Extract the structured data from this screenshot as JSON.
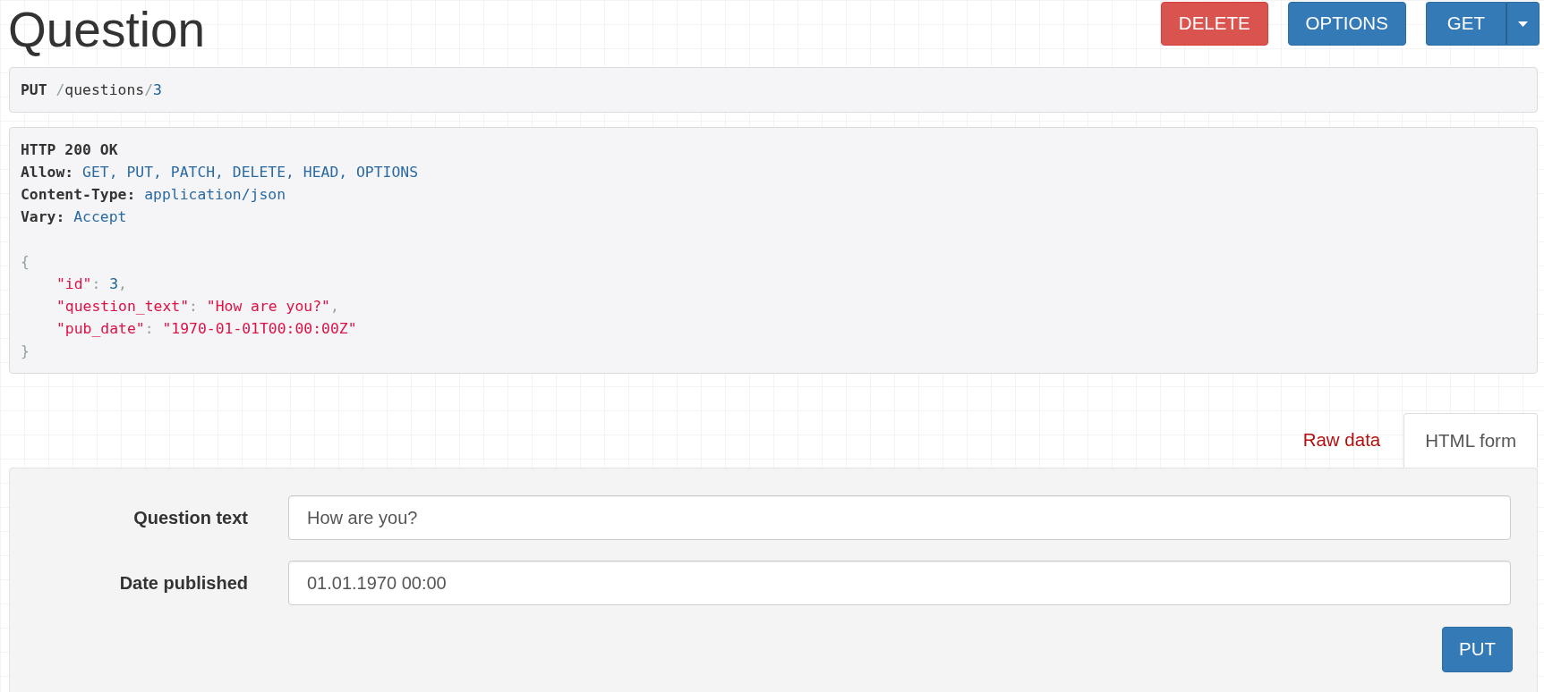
{
  "page": {
    "title": "Question"
  },
  "actions": [
    {
      "label": "DELETE",
      "kind": "danger"
    },
    {
      "label": "OPTIONS",
      "kind": "primary"
    },
    {
      "label": "GET",
      "kind": "split"
    }
  ],
  "request": {
    "method": "PUT",
    "path": [
      {
        "text": "/",
        "kind": "punct"
      },
      {
        "text": "questions",
        "kind": "plain"
      },
      {
        "text": "/",
        "kind": "punct"
      },
      {
        "text": "3",
        "kind": "literal"
      }
    ]
  },
  "response": {
    "status": "HTTP 200 OK",
    "headers": [
      {
        "name": "Allow:",
        "value": "GET, PUT, PATCH, DELETE, HEAD, OPTIONS"
      },
      {
        "name": "Content-Type:",
        "value": "application/json"
      },
      {
        "name": "Vary:",
        "value": "Accept"
      }
    ],
    "body": {
      "open": "{",
      "members": [
        {
          "tokens": [
            {
              "text": "\"id\"",
              "kind": "key"
            },
            {
              "text": ": ",
              "kind": "punct"
            },
            {
              "text": "3",
              "kind": "number"
            },
            {
              "text": ",",
              "kind": "punct"
            }
          ]
        },
        {
          "tokens": [
            {
              "text": "\"question_text\"",
              "kind": "key"
            },
            {
              "text": ": ",
              "kind": "punct"
            },
            {
              "text": "\"How are you?\"",
              "kind": "string"
            },
            {
              "text": ",",
              "kind": "punct"
            }
          ]
        },
        {
          "tokens": [
            {
              "text": "\"pub_date\"",
              "kind": "key"
            },
            {
              "text": ": ",
              "kind": "punct"
            },
            {
              "text": "\"1970-01-01T00:00:00Z\"",
              "kind": "string"
            }
          ]
        }
      ],
      "close": "}"
    }
  },
  "tabs": [
    {
      "label": "Raw data",
      "selected": false
    },
    {
      "label": "HTML form",
      "selected": true
    }
  ],
  "form": {
    "fields": [
      {
        "label": "Question text",
        "value": "How are you?"
      },
      {
        "label": "Date published",
        "value": "01.01.1970 00:00"
      }
    ],
    "submit": "PUT"
  }
}
